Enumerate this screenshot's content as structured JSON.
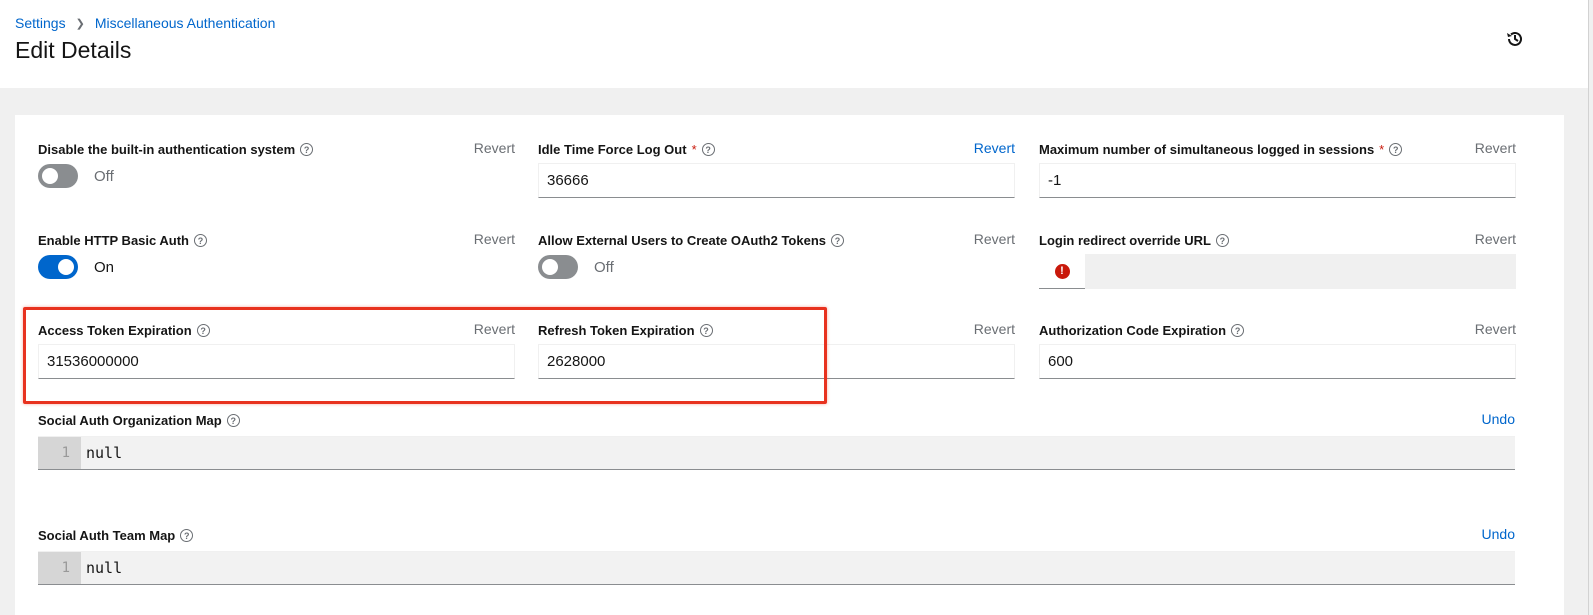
{
  "breadcrumb": {
    "items": [
      "Settings",
      "Miscellaneous Authentication"
    ]
  },
  "page_title": "Edit Details",
  "fields": {
    "disable_builtin": {
      "label": "Disable the built-in authentication system",
      "action": "Revert",
      "state": "Off"
    },
    "idle_timeout": {
      "label": "Idle Time Force Log Out",
      "required": "*",
      "action": "Revert",
      "value": "36666"
    },
    "max_sessions": {
      "label": "Maximum number of simultaneous logged in sessions",
      "required": "*",
      "action": "Revert",
      "value": "-1"
    },
    "http_basic": {
      "label": "Enable HTTP Basic Auth",
      "action": "Revert",
      "state": "On"
    },
    "external_oauth": {
      "label": "Allow External Users to Create OAuth2 Tokens",
      "action": "Revert",
      "state": "Off"
    },
    "login_redirect": {
      "label": "Login redirect override URL",
      "action": "Revert",
      "value": ""
    },
    "access_token": {
      "label": "Access Token Expiration",
      "action": "Revert",
      "value": "31536000000"
    },
    "refresh_token": {
      "label": "Refresh Token Expiration",
      "action": "Revert",
      "value": "2628000"
    },
    "auth_code": {
      "label": "Authorization Code Expiration",
      "action": "Revert",
      "value": "600"
    },
    "org_map": {
      "label": "Social Auth Organization Map",
      "action": "Undo",
      "line": "1",
      "code": "null"
    },
    "team_map": {
      "label": "Social Auth Team Map",
      "action": "Undo",
      "line": "1",
      "code": "null"
    }
  },
  "colors": {
    "link": "#0066cc",
    "highlight": "#e8321f",
    "error": "#c9190b"
  }
}
